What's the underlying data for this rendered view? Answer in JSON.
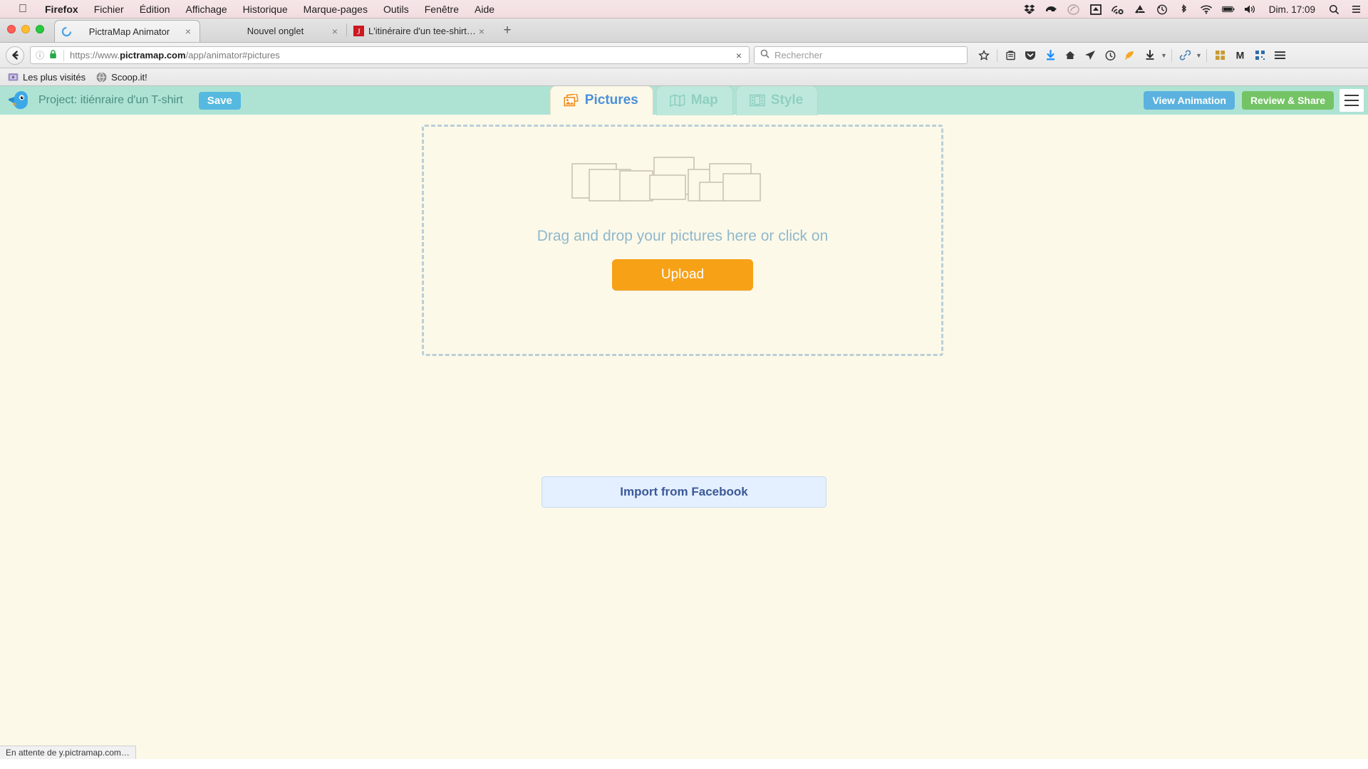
{
  "menubar": {
    "apple_icon": "apple-logo",
    "items": [
      {
        "label": "Firefox",
        "bold": true
      },
      {
        "label": "Fichier",
        "bold": false
      },
      {
        "label": "Édition",
        "bold": false
      },
      {
        "label": "Affichage",
        "bold": false
      },
      {
        "label": "Historique",
        "bold": false
      },
      {
        "label": "Marque-pages",
        "bold": false
      },
      {
        "label": "Outils",
        "bold": false
      },
      {
        "label": "Fenêtre",
        "bold": false
      },
      {
        "label": "Aide",
        "bold": false
      }
    ],
    "status_icons": [
      "dropbox-icon",
      "little-snitch-icon",
      "creative-cloud-icon",
      "eject-icon",
      "airdrop-disabled-icon",
      "google-drive-icon",
      "time-machine-icon",
      "bluetooth-icon",
      "wifi-icon",
      "battery-icon",
      "volume-icon"
    ],
    "time": "Dim. 17:09",
    "right_icons": [
      "search-icon",
      "notification-center-icon"
    ]
  },
  "browser": {
    "tabs": [
      {
        "title": "PictraMap Animator",
        "favicon": "loading-spinner-icon",
        "active": true,
        "close": "×"
      },
      {
        "title": "Nouvel onglet",
        "favicon": "",
        "active": false,
        "close": "×"
      },
      {
        "title": "L'itinéraire d'un tee-shirt : le ",
        "favicon": "journal-j-icon",
        "active": false,
        "close": "×"
      }
    ],
    "new_tab_label": "+",
    "nav": {
      "back_icon": "back-arrow-icon",
      "info_icon": "info-circle-icon",
      "lock_icon": "padlock-icon",
      "url_prefix": "https://www.",
      "url_domain": "pictramap.com",
      "url_suffix": "/app/animator#pictures",
      "url_full": "https://www.pictramap.com/app/animator#pictures",
      "stop_icon": "×"
    },
    "search": {
      "placeholder": "Rechercher",
      "icon": "search-icon"
    },
    "toolbar_icons": [
      "star-icon",
      "reader-icon",
      "pocket-icon",
      "download-arrow-icon",
      "home-icon",
      "send-tab-icon",
      "shield-icon",
      "honey-icon",
      "download-manager-icon",
      "chevron-down-icon",
      "link-icon",
      "chevron-down-icon-2",
      "grid-icon",
      "m-icon",
      "qr-icon",
      "menu-hamburger-icon"
    ],
    "bookmarks": [
      {
        "label": "Les plus visités",
        "icon": "folder-star-icon"
      },
      {
        "label": "Scoop.it!",
        "icon": "globe-icon"
      }
    ]
  },
  "app": {
    "logo_icon": "blue-bird-logo",
    "project_title": "Project: itiénraire d'un T-shirt",
    "save_label": "Save",
    "tabs": [
      {
        "label": "Pictures",
        "icon": "pictures-icon",
        "active": true
      },
      {
        "label": "Map",
        "icon": "map-icon",
        "active": false
      },
      {
        "label": "Style",
        "icon": "film-strip-icon",
        "active": false
      }
    ],
    "view_animation_label": "View Animation",
    "review_share_label": "Review & Share",
    "menu_icon": "hamburger-menu-icon",
    "dropzone": {
      "illustration": "photo-stack-illustration",
      "prompt": "Drag and drop your pictures here or click on",
      "upload_label": "Upload"
    },
    "facebook_import_label": "Import from Facebook"
  },
  "status": {
    "message": "En attente de y.pictramap.com…"
  },
  "colors": {
    "app_header": "#aee3d4",
    "page_bg": "#fdf9e8",
    "accent_orange": "#f7a117",
    "accent_blue": "#4a90d9",
    "save_blue": "#56b9e0",
    "review_green": "#74c365",
    "facebook_blue": "#3b5998"
  }
}
